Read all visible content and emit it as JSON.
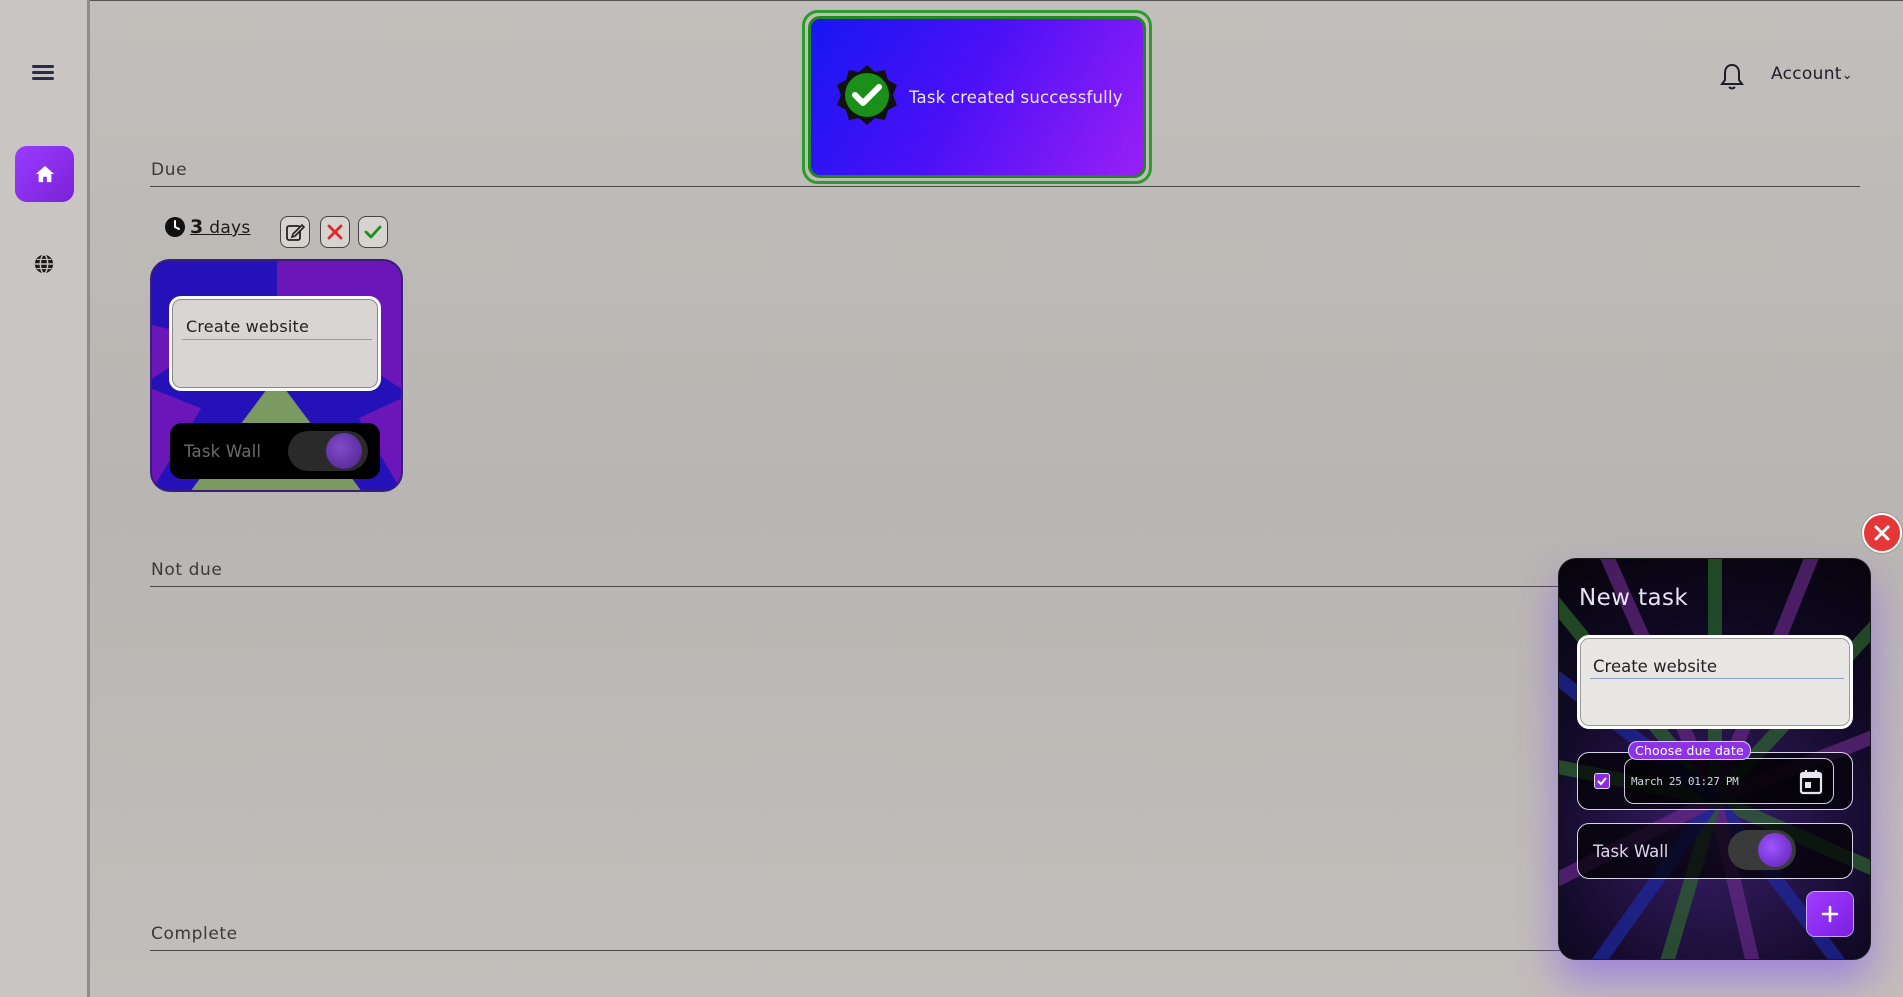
{
  "header": {
    "account_label": "Account"
  },
  "toast": {
    "message": "Task created successfully"
  },
  "sections": {
    "due": "Due",
    "not_due": "Not due",
    "complete": "Complete"
  },
  "task_card": {
    "due_count": "3",
    "due_unit": "days",
    "title": "Create website",
    "task_wall_label": "Task Wall",
    "task_wall_on": false
  },
  "new_task": {
    "title": "New task",
    "task_title_value": "Create website",
    "due_date_chip": "Choose due date",
    "due_date_value": "March 25 01:27 PM",
    "due_enabled": true,
    "task_wall_label": "Task Wall",
    "task_wall_on": true
  },
  "colors": {
    "accent": "#8a2be2",
    "toast_border": "#2a9d2a",
    "danger": "#e43838"
  }
}
